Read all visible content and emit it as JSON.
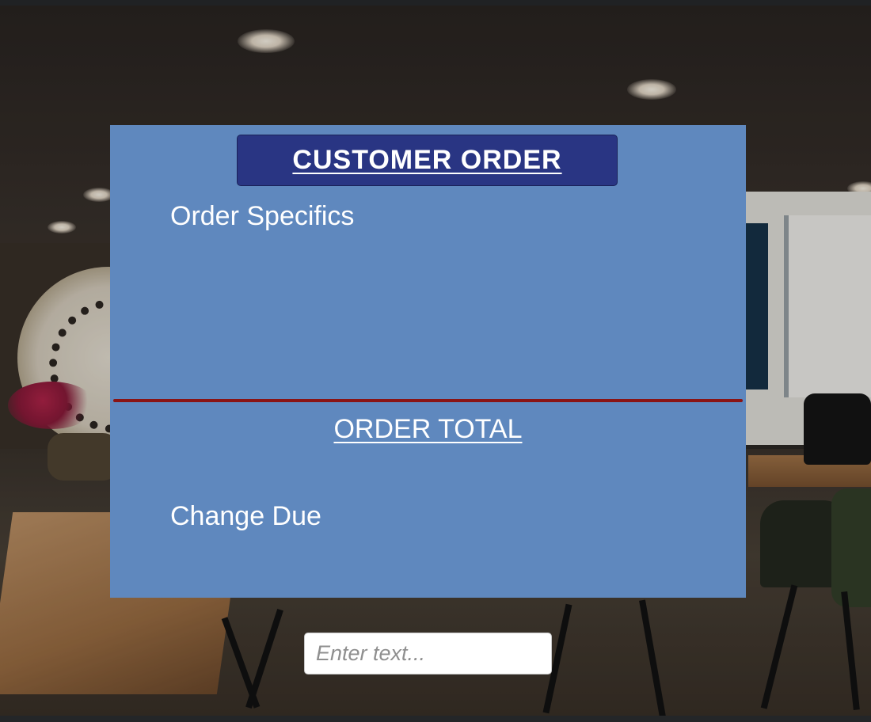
{
  "order_panel": {
    "title": "CUSTOMER ORDER",
    "order_specifics_label": "Order Specifics",
    "order_total_label": "ORDER TOTAL",
    "change_due_label": "Change Due"
  },
  "text_input": {
    "placeholder": "Enter text...",
    "value": ""
  },
  "colors": {
    "panel_background": "#5f88be",
    "title_background": "#293583",
    "divider": "#8a1414",
    "text": "#ffffff"
  }
}
